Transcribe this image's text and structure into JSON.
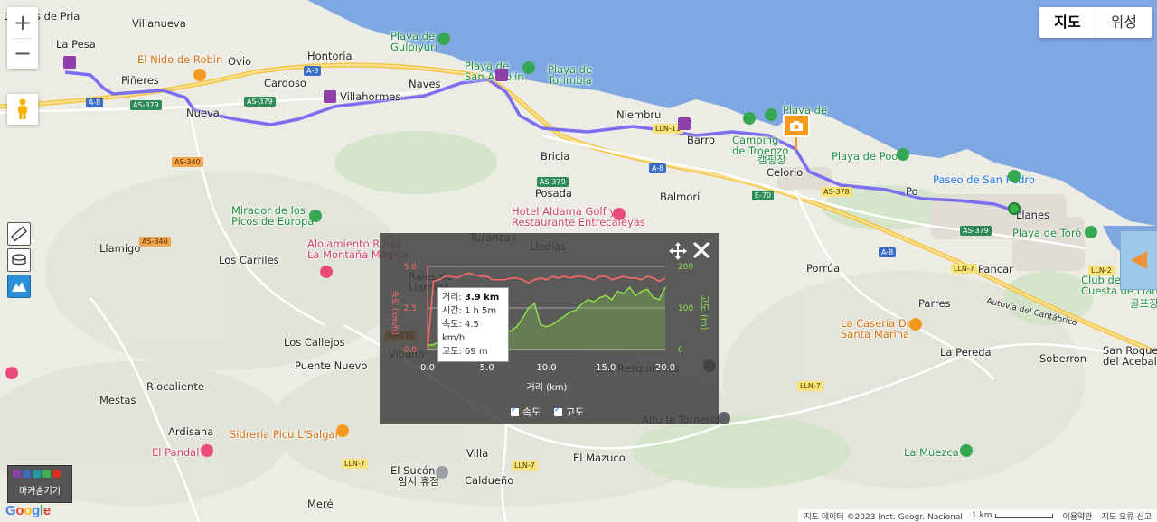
{
  "map": {
    "type_buttons": [
      "지도",
      "위성"
    ],
    "active_type": "지도",
    "zoom_in": "+",
    "zoom_out": "−",
    "places": [
      {
        "id": "la-pria",
        "text": "Llames de Pria",
        "cls": ""
      },
      {
        "id": "villanueva",
        "text": "Villanueva",
        "cls": ""
      },
      {
        "id": "la-pesa",
        "text": "La Pesa",
        "cls": ""
      },
      {
        "id": "nido",
        "text": "El Nido de Robin",
        "cls": "poi-orange"
      },
      {
        "id": "ovio",
        "text": "Ovio",
        "cls": ""
      },
      {
        "id": "hontoria",
        "text": "Hontoria",
        "cls": ""
      },
      {
        "id": "gulpiyuri",
        "text": "Playa de\nGulpiyuri",
        "cls": "poi-green"
      },
      {
        "id": "san-antolin",
        "text": "Playa de\nSan Antolín",
        "cls": "poi-green"
      },
      {
        "id": "torimbia",
        "text": "Playa de\nTorimbia",
        "cls": "poi-green"
      },
      {
        "id": "pineres",
        "text": "Piñeres",
        "cls": ""
      },
      {
        "id": "cardoso",
        "text": "Cardoso",
        "cls": ""
      },
      {
        "id": "villahormes",
        "text": "Villahormes",
        "cls": ""
      },
      {
        "id": "naves",
        "text": "Naves",
        "cls": ""
      },
      {
        "id": "nueva",
        "text": "Nueva",
        "cls": ""
      },
      {
        "id": "niembru",
        "text": "Niembru",
        "cls": ""
      },
      {
        "id": "barro",
        "text": "Barro",
        "cls": ""
      },
      {
        "id": "camping",
        "text": "Camping\nde Troenzo",
        "cls": "poi-green"
      },
      {
        "id": "camping-kr",
        "text": "캠핑장",
        "cls": "poi-green"
      },
      {
        "id": "playa-de",
        "text": "Playa de",
        "cls": "poi-green"
      },
      {
        "id": "celorio",
        "text": "Celorio",
        "cls": ""
      },
      {
        "id": "poo",
        "text": "Playa de Poo",
        "cls": "poi-green"
      },
      {
        "id": "paseo",
        "text": "Paseo de San Pedro",
        "cls": "sea"
      },
      {
        "id": "bricia",
        "text": "Bricia",
        "cls": ""
      },
      {
        "id": "posada",
        "text": "Posada",
        "cls": ""
      },
      {
        "id": "balmori",
        "text": "Balmori",
        "cls": ""
      },
      {
        "id": "po",
        "text": "Po",
        "cls": ""
      },
      {
        "id": "llanes",
        "text": "Llanes",
        "cls": ""
      },
      {
        "id": "toro",
        "text": "Playa de Toró",
        "cls": "poi-green"
      },
      {
        "id": "mirador",
        "text": "Mirador de los\nPicos de Europa",
        "cls": "poi-green"
      },
      {
        "id": "aldama",
        "text": "Hotel Aldama Golf y\nRestaurante Entrecaleyas",
        "cls": "poi-pink"
      },
      {
        "id": "turanzas",
        "text": "Turanzas",
        "cls": ""
      },
      {
        "id": "lledias",
        "text": "Lledías",
        "cls": ""
      },
      {
        "id": "llamigo",
        "text": "Llamigo",
        "cls": ""
      },
      {
        "id": "carriles",
        "text": "Los Carriles",
        "cls": ""
      },
      {
        "id": "alojamiento",
        "text": "Alojamiento Rural\nLa Montaña Mágica",
        "cls": "poi-pink"
      },
      {
        "id": "porrua",
        "text": "Porrúa",
        "cls": ""
      },
      {
        "id": "pancar",
        "text": "Pancar",
        "cls": ""
      },
      {
        "id": "club",
        "text": "Club de\nCuesta de Llanes",
        "cls": "poi-green"
      },
      {
        "id": "golf-kr",
        "text": "골프장",
        "cls": "poi-green"
      },
      {
        "id": "parres",
        "text": "Parres",
        "cls": ""
      },
      {
        "id": "caseria",
        "text": "La Casería De\nSanta Marina",
        "cls": "poi-orange"
      },
      {
        "id": "pereda",
        "text": "La Pereda",
        "cls": ""
      },
      {
        "id": "autovia",
        "text": "Autovía del Cantábrico",
        "cls": ""
      },
      {
        "id": "san-roque",
        "text": "San Roque\ndel Acebal",
        "cls": ""
      },
      {
        "id": "soberron",
        "text": "Soberron",
        "cls": ""
      },
      {
        "id": "callejos",
        "text": "Los Callejos",
        "cls": ""
      },
      {
        "id": "rales",
        "text": "Rales de\nLlamigo",
        "cls": ""
      },
      {
        "id": "vibano",
        "text": "Vibaño",
        "cls": ""
      },
      {
        "id": "puente",
        "text": "Puente Nuevo",
        "cls": ""
      },
      {
        "id": "riocaliente",
        "text": "Riocaliente",
        "cls": ""
      },
      {
        "id": "mestas",
        "text": "Mestas",
        "cls": ""
      },
      {
        "id": "restaurant-pinones",
        "text": "Los Resquilones",
        "cls": ""
      },
      {
        "id": "torneria",
        "text": "Altu la Tornería",
        "cls": ""
      },
      {
        "id": "ardisana",
        "text": "Ardisana",
        "cls": ""
      },
      {
        "id": "sidreria",
        "text": "Sidrería Picu L'Salgar",
        "cls": "poi-orange"
      },
      {
        "id": "pandal",
        "text": "El Pandal",
        "cls": "poi-pink"
      },
      {
        "id": "villa",
        "text": "Villa",
        "cls": ""
      },
      {
        "id": "mazuco",
        "text": "El Mazuco",
        "cls": ""
      },
      {
        "id": "sucon",
        "text": "El Sucón",
        "cls": ""
      },
      {
        "id": "sucon-kr",
        "text": "임시 휴점",
        "cls": ""
      },
      {
        "id": "caldueno",
        "text": "Caldueño",
        "cls": ""
      },
      {
        "id": "muezca",
        "text": "La Muezca",
        "cls": "poi-green"
      },
      {
        "id": "mere",
        "text": "Meré",
        "cls": ""
      }
    ],
    "roads": [
      "A-8",
      "A-8",
      "A-8",
      "A-8",
      "AS-379",
      "AS-379",
      "AS-379",
      "AS-379",
      "AS-340",
      "AS-340",
      "AS-115",
      "LLN-11",
      "E-70",
      "AS-378",
      "LLN-7",
      "LLN-7",
      "LLN-7",
      "LLN-7",
      "LLN-2"
    ],
    "marker_legend_label": "마커숨기기",
    "google": "Google",
    "footer": {
      "data": "지도 데이터 ©2023 Inst. Geogr. Nacional",
      "scale": "1 km",
      "terms": "이용약관",
      "report": "지도 오류 신고"
    }
  },
  "elevation_panel": {
    "y_left_label": "속도 (km/h)",
    "y_right_label": "고도 (m)",
    "x_label": "거리 (km)",
    "tooltip": {
      "distance_label": "거리:",
      "distance_value": "3.9 km",
      "time_label": "시간:",
      "time_value": "1 h 5m",
      "speed_label": "속도:",
      "speed_value": "4.5 km/h",
      "alt_label": "고도:",
      "alt_value": "69 m"
    },
    "check_speed": "속도",
    "check_alt": "고도"
  },
  "chart_data": {
    "type": "line",
    "x": [
      0,
      0.5,
      1,
      1.5,
      2,
      2.5,
      3,
      3.5,
      3.9,
      4.5,
      5,
      5.5,
      6,
      6.5,
      7,
      7.5,
      8,
      8.5,
      9,
      9.5,
      10,
      10.5,
      11,
      11.5,
      12,
      12.5,
      13,
      13.5,
      14,
      14.5,
      15,
      15.5,
      16,
      16.5,
      17,
      17.5,
      18,
      18.5,
      19,
      19.5,
      20
    ],
    "series": [
      {
        "name": "속도",
        "axis": "left",
        "color": "#ff6a6a",
        "values": [
          0,
          4.1,
          4.2,
          4.4,
          4.4,
          4.3,
          4.5,
          4.6,
          4.5,
          4.4,
          4.4,
          4.2,
          4.2,
          4.2,
          4.3,
          4.3,
          4.2,
          4.0,
          4.2,
          4.3,
          4.2,
          4.4,
          4.3,
          4.4,
          4.3,
          4.4,
          4.4,
          4.3,
          4.2,
          4.4,
          4.4,
          4.2,
          4.3,
          4.4,
          4.3,
          4.3,
          4.2,
          4.4,
          4.3,
          4.1,
          4.3
        ]
      },
      {
        "name": "고도",
        "axis": "right",
        "color": "#8fe04a",
        "values": [
          10,
          12,
          18,
          25,
          40,
          45,
          55,
          50,
          69,
          60,
          45,
          40,
          38,
          40,
          45,
          55,
          75,
          100,
          110,
          60,
          55,
          60,
          70,
          80,
          90,
          95,
          110,
          120,
          115,
          125,
          130,
          120,
          140,
          135,
          150,
          130,
          140,
          145,
          125,
          120,
          150
        ]
      }
    ],
    "xlabel": "거리 (km)",
    "ylabel": "속도 (km/h)",
    "y2label": "고도 (m)",
    "xlim": [
      0,
      20
    ],
    "ylim": [
      0,
      5
    ],
    "y2lim": [
      0,
      200
    ],
    "xticks": [
      "0.0",
      "5.0",
      "10.0",
      "15.0",
      "20.0"
    ],
    "yticks": [
      "0.0",
      "2.5",
      "5.0"
    ],
    "y2ticks": [
      "0",
      "100",
      "200"
    ]
  }
}
